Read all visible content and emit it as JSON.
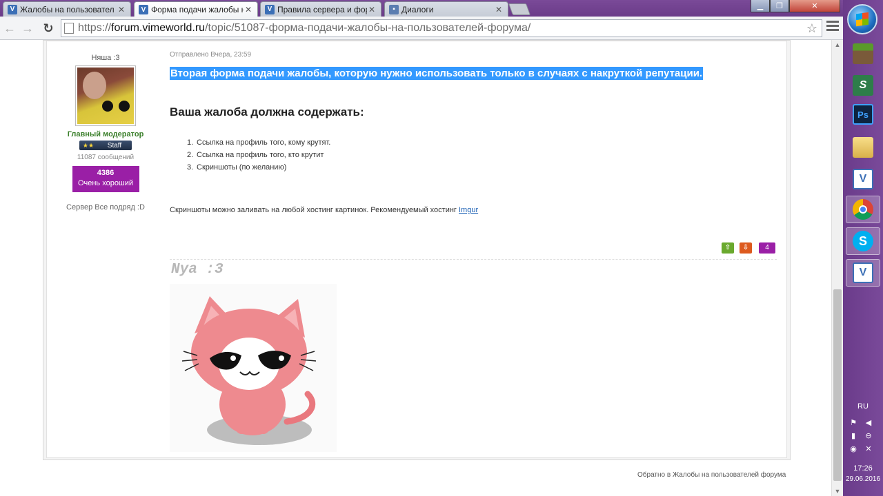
{
  "browser": {
    "tabs": [
      {
        "title": "Жалобы на пользовател",
        "icon": "vimeworld-icon"
      },
      {
        "title": "Форма подачи жалобы н",
        "icon": "vimeworld-icon"
      },
      {
        "title": "Правила сервера и фор",
        "icon": "vimeworld-icon"
      },
      {
        "title": "Диалоги",
        "icon": "dialog-icon"
      }
    ],
    "url": {
      "prefix": "https://",
      "domain": "forum.vimeworld.ru",
      "path": "/topic/51087-форма-подачи-жалобы-на-пользователей-форума/"
    }
  },
  "author": {
    "name": "Няша :3",
    "group": "Главный модератор",
    "badge": "Staff",
    "badge_stars": "★★",
    "post_count": "11087 сообщений",
    "reputation": "4386",
    "reputation_label": "Очень хороший",
    "server_label": "Сервер",
    "server_value": "Все подряд :D"
  },
  "post": {
    "posted": "Отправлено Вчера, 23:59",
    "highlight": "Вторая форма подачи жалобы, которую нужно использовать только в случаях с накруткой репутации.",
    "heading": "Ваша жалоба должна содержать:",
    "items": [
      "Ссылка на профиль того, кому крутят.",
      "Ссылка на профиль того, кто крутит",
      "Скриншоты (по желанию)"
    ],
    "hosting_text": "Скриншоты можно заливать на любой хостинг картинок. Рекомендуемый хостинг ",
    "hosting_link": "Imgur",
    "rep_up": "⇧",
    "rep_down": "⇩",
    "rep_value": "4",
    "signature": "Nya :3"
  },
  "footer": {
    "back_link": "Обратно в Жалобы на пользователей форума"
  },
  "taskbar": {
    "lang": "RU",
    "time": "17:26",
    "date": "29.06.2016"
  },
  "colors": {
    "highlight": "#3399ff",
    "group": "#3a7f2a",
    "reputation": "#9a1fa6",
    "taskbar": "#6d3d8c"
  }
}
